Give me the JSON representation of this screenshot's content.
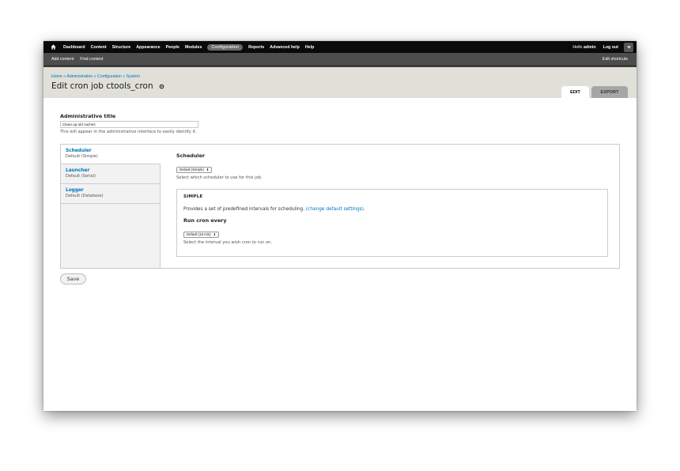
{
  "toolbar": {
    "items": [
      "Dashboard",
      "Content",
      "Structure",
      "Appearance",
      "People",
      "Modules",
      "Configuration",
      "Reports",
      "Advanced help",
      "Help"
    ],
    "active": "Configuration",
    "hello_prefix": "Hello ",
    "user": "admin",
    "logout": "Log out"
  },
  "shortcuts": {
    "add_content": "Add content",
    "find_content": "Find content",
    "edit_shortcuts": "Edit shortcuts"
  },
  "header": {
    "breadcrumb": "Home » Administration » Configuration » System",
    "title": "Edit cron job ctools_cron",
    "tabs": [
      "EDIT",
      "EXPORT"
    ]
  },
  "form": {
    "admin_title_label": "Administrative title",
    "admin_title_value": "Clean up old caches",
    "admin_title_desc": "This will appear in the administrative interface to easily identify it.",
    "vertical_tabs": [
      {
        "title": "Scheduler",
        "summary": "Default (Simple)"
      },
      {
        "title": "Launcher",
        "summary": "Default (Serial)"
      },
      {
        "title": "Logger",
        "summary": "Default (Database)"
      }
    ],
    "scheduler_label": "Scheduler",
    "scheduler_value": "Default (Simple)",
    "scheduler_desc": "Select which scheduler to use for this job.",
    "fieldset_legend": "SIMPLE",
    "fieldset_text": "Provides a set of predefined intervals for scheduling.",
    "fieldset_link": "(change default settings)",
    "fieldset_period": ".",
    "run_label": "Run cron every",
    "run_value": "Default (15 min)",
    "run_desc": "Select the interval you wish cron to run on.",
    "save": "Save"
  },
  "icons": {
    "home": "home-icon",
    "gear": "gear-icon",
    "toggle": "chevron-down-icon",
    "select_arrow": "up-down-arrow-icon"
  },
  "colors": {
    "toolbar_bg": "#0a0a0a",
    "shortcuts_bg": "#4d4d4d",
    "header_bg": "#e0e0d8",
    "link": "#0074bd"
  }
}
